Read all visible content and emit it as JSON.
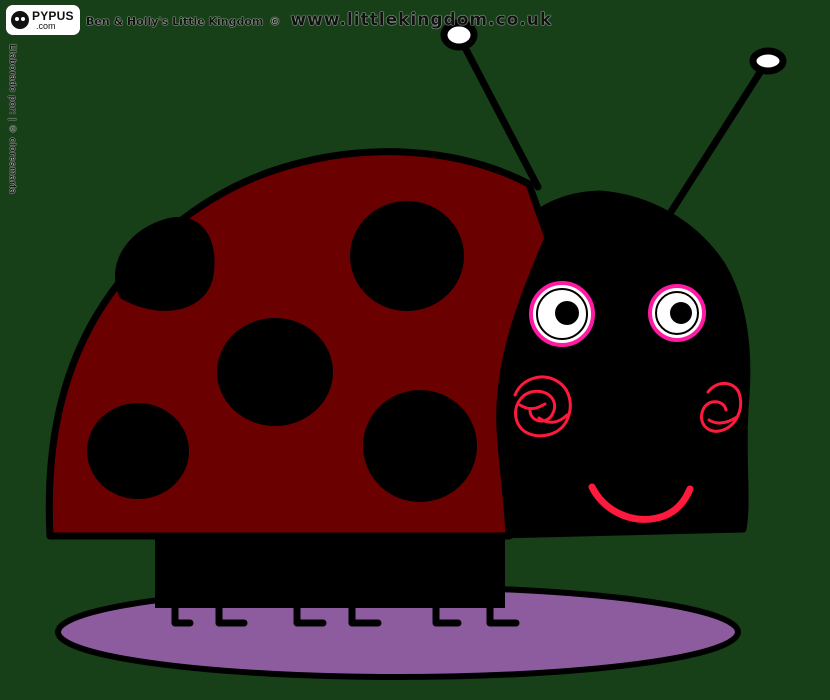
{
  "watermark": {
    "logo_main": "PYPUS",
    "logo_sub": ".com",
    "credit": "Ben & Holly's Little Kingdom",
    "copyright": "©",
    "url": "www.littlekingdom.co.uk",
    "side_text": "Elaborado por: | © cloresmarta"
  },
  "colors": {
    "background": "#173f18",
    "shell": "#6b0000",
    "outline": "#000000",
    "head": "#000000",
    "spots": "#000000",
    "eye_ring": "#ff1aa3",
    "eye_white": "#ffffff",
    "cheeks": "#ff1a3d",
    "smile": "#ff1a3d",
    "shadow": "#8d5c9f",
    "antenna_tip": "#ffffff"
  },
  "icons": {
    "logo": "skull-icon"
  }
}
